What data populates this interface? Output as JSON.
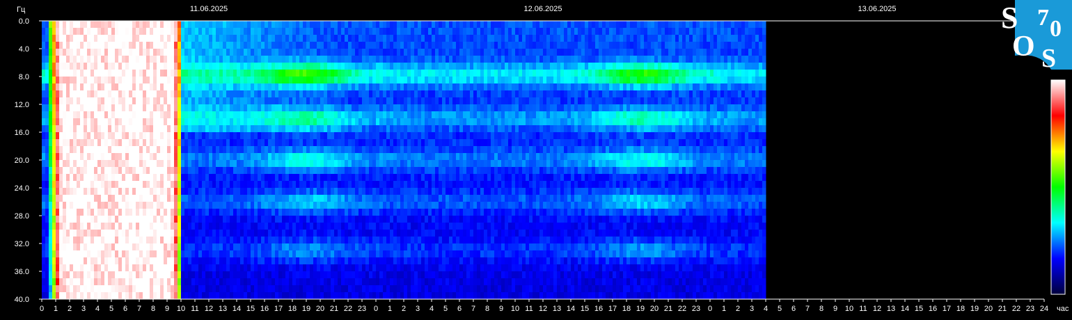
{
  "chart_data": {
    "type": "heatmap",
    "title": "",
    "ylabel": "Гц",
    "xlabel": "час",
    "ylim": [
      0,
      40
    ],
    "y_reversed": true,
    "y_ticks": [
      "0.0",
      "4.0",
      "8.0",
      "12.0",
      "16.0",
      "20.0",
      "24.0",
      "28.0",
      "32.0",
      "36.0",
      "40.0"
    ],
    "dates": [
      "11.06.2025",
      "12.06.2025",
      "13.06.2025"
    ],
    "hours_per_day": 24,
    "x_tick_labels": [
      "0",
      "1",
      "2",
      "3",
      "4",
      "5",
      "6",
      "7",
      "8",
      "9",
      "10",
      "11",
      "12",
      "13",
      "14",
      "15",
      "16",
      "17",
      "18",
      "19",
      "20",
      "21",
      "22",
      "23",
      "0",
      "1",
      "2",
      "3",
      "4",
      "5",
      "6",
      "7",
      "8",
      "9",
      "10",
      "11",
      "12",
      "13",
      "14",
      "15",
      "16",
      "17",
      "18",
      "19",
      "20",
      "21",
      "22",
      "23",
      "0",
      "1",
      "2",
      "3",
      "4",
      "5",
      "6",
      "7",
      "8",
      "9",
      "10",
      "11",
      "12",
      "13",
      "14",
      "15",
      "16",
      "17",
      "18",
      "19",
      "20",
      "21",
      "22",
      "23",
      "24"
    ],
    "data_end_hour": 52.0,
    "resonance_bands_hz": [
      7.8,
      14.1,
      20.0,
      26.0,
      33.0
    ],
    "high_intensity_interval_hours": [
      0.5,
      10.0
    ],
    "colorscale": [
      "#00003c",
      "#0000ff",
      "#00ffff",
      "#00ff00",
      "#ffff00",
      "#ff0000",
      "#ffffff"
    ],
    "grid": false,
    "legend": "colorbar-right"
  },
  "logo": {
    "letters": [
      "S",
      "7",
      "0",
      "O",
      "S"
    ],
    "color": "#1a9ad8"
  }
}
